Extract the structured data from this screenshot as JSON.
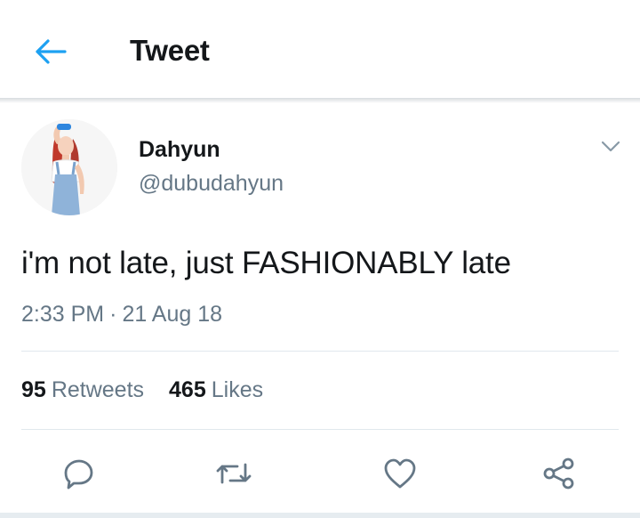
{
  "header": {
    "title": "Tweet",
    "back_icon": "arrow-left-icon",
    "accent": "#1da1f2"
  },
  "tweet": {
    "author": {
      "display_name": "Dahyun",
      "handle": "@dubudahyun",
      "avatar": "avatar-photo"
    },
    "text": "i'm not late, just FASHIONABLY late",
    "time": "2:33 PM",
    "separator": "·",
    "date": "21 Aug 18",
    "stats": {
      "retweets_count": "95",
      "retweets_label": "Retweets",
      "likes_count": "465",
      "likes_label": "Likes"
    },
    "actions": [
      "reply-icon",
      "retweet-icon",
      "heart-icon",
      "share-icon"
    ]
  },
  "colors": {
    "text_primary": "#14171a",
    "text_secondary": "#657786",
    "divider": "#e1e8ed",
    "accent": "#1da1f2"
  }
}
